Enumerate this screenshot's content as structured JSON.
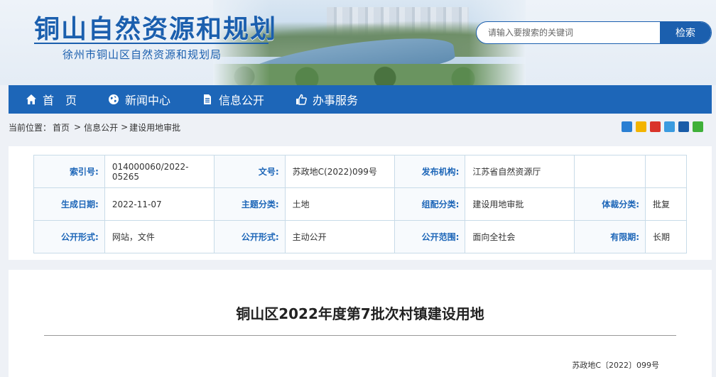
{
  "header": {
    "title": "铜山自然资源和规划",
    "subtitle": "徐州市铜山区自然资源和规划局",
    "search_placeholder": "请输入要搜索的关键词",
    "search_button": "检索"
  },
  "nav": {
    "items": [
      {
        "label": "首　页",
        "icon": "home-icon"
      },
      {
        "label": "新闻中心",
        "icon": "globe-icon"
      },
      {
        "label": "信息公开",
        "icon": "document-icon"
      },
      {
        "label": "办事服务",
        "icon": "thumbs-up-icon"
      }
    ]
  },
  "breadcrumb": {
    "prefix": "当前位置：",
    "items": [
      "首页",
      "信息公开",
      "建设用地审批"
    ],
    "sep1": ">",
    "sep2": ">"
  },
  "share_icons": [
    "share-qzone-icon",
    "share-weibo-icon",
    "share-renren-icon",
    "share-qq-icon",
    "share-people-icon",
    "share-wechat-icon"
  ],
  "info": {
    "row1": {
      "l1": "索引号:",
      "v1": "014000060/2022-05265",
      "l2": "文号:",
      "v2": "苏政地C(2022)099号",
      "l3": "发布机构:",
      "v3": "江苏省自然资源厅",
      "l4": "",
      "v4": ""
    },
    "row2": {
      "l1": "生成日期:",
      "v1": "2022-11-07",
      "l2": "主题分类:",
      "v2": "土地",
      "l3": "组配分类:",
      "v3": "建设用地审批",
      "l4": "体裁分类:",
      "v4": "批复"
    },
    "row3": {
      "l1": "公开形式:",
      "v1": "网站，文件",
      "l2": "公开形式:",
      "v2": "主动公开",
      "l3": "公开范围:",
      "v3": "面向全社会",
      "l4": "有限期:",
      "v4": "长期"
    }
  },
  "article": {
    "title": "铜山区2022年度第7批次村镇建设用地",
    "doc_no": "苏政地C〔2022〕099号"
  },
  "colors": {
    "primary": "#1d66b8",
    "title_blue": "#1b5fae",
    "table_border": "#c8dbe8"
  }
}
